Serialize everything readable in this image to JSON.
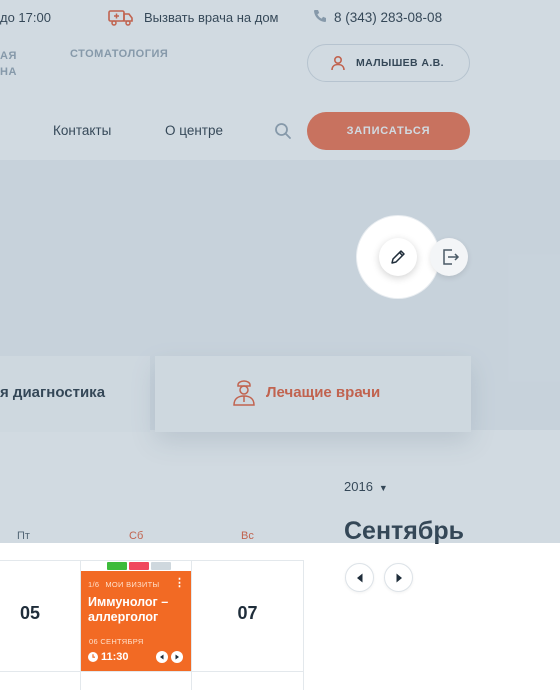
{
  "topbar": {
    "hours": "до 17:00",
    "call_home": "Вызвать врача на дом",
    "phone": "8 (343) 283-08-08"
  },
  "subnav": {
    "item1_line1": "АЯ",
    "item1_line2": "НА",
    "item2": "СТОМАТОЛОГИЯ",
    "profile_name": "МАЛЫШЕВ А.В."
  },
  "menu": {
    "item_partial": "",
    "contacts": "Контакты",
    "about": "О центре",
    "cta": "ЗАПИСАТЬСЯ"
  },
  "cards": {
    "diagnostics": "я диагностика",
    "doctors": "Лечащие врачи"
  },
  "calendar": {
    "year": "2016",
    "month": "Сентябрь",
    "weekdays": [
      "Пт",
      "Сб",
      "Вс"
    ],
    "days": [
      "05",
      "07"
    ],
    "event": {
      "counter": "1/6",
      "label": "МОИ ВИЗИТЫ",
      "title": "Иммунолог – аллерголог",
      "date": "06 СЕНТЯБРЯ",
      "time": "11:30",
      "tag_colors": [
        "#3dbb3b",
        "#f0475d",
        "#cfd8de"
      ]
    }
  },
  "colors": {
    "accent": "#f26a45",
    "event_bg": "#f26a24",
    "overlay": "rgba(104,134,156,0.30)"
  }
}
